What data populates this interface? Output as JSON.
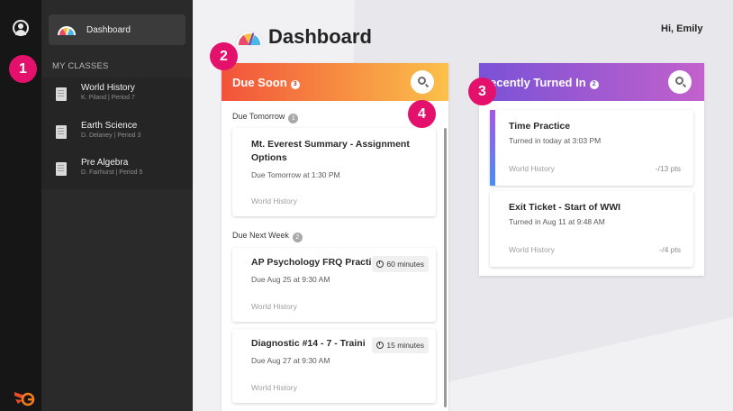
{
  "nav": {
    "dashboard_label": "Dashboard"
  },
  "sidebar": {
    "section_label": "MY CLASSES",
    "classes": [
      {
        "name": "World History",
        "sub": "K. Piland  |  Period 7"
      },
      {
        "name": "Earth Science",
        "sub": "D. Delaney  |  Period 3"
      },
      {
        "name": "Pre Algebra",
        "sub": "D. Fairhurst  |  Period 5"
      }
    ]
  },
  "header": {
    "title": "Dashboard",
    "greeting": "Hi, Emily"
  },
  "badges": [
    "1",
    "2",
    "3",
    "4"
  ],
  "due_soon": {
    "title": "Due Soon",
    "count": "3",
    "sections": [
      {
        "label": "Due Tomorrow",
        "count": "1"
      },
      {
        "label": "Due Next Week",
        "count": "2"
      }
    ],
    "cards": [
      {
        "title": "Mt. Everest Summary - Assignment Options",
        "due": "Due Tomorrow at 1:30 PM",
        "class": "World History"
      },
      {
        "title": "AP Psychology FRQ Practi",
        "duration": "60 minutes",
        "due": "Due Aug 25 at 9:30 AM",
        "class": "World History"
      },
      {
        "title": "Diagnostic #14 - 7 - Traini",
        "duration": "15 minutes",
        "due": "Due Aug 27 at 9:30 AM",
        "class": "World History"
      }
    ]
  },
  "turned_in": {
    "title": "ecently Turned In",
    "count": "2",
    "cards": [
      {
        "title": "Time Practice",
        "status": "Turned in today at 3:03 PM",
        "class": "World History",
        "points": "-/13 pts"
      },
      {
        "title": "Exit Ticket - Start of WWI",
        "status": "Turned in Aug 11 at 9:48 AM",
        "class": "World History",
        "points": "-/4 pts"
      }
    ]
  },
  "colors": {
    "accent_badge": "#e3116c",
    "due_soon_gradient": [
      "#f2533a",
      "#fbc14a"
    ],
    "turned_in_gradient": [
      "#7a52d6",
      "#c261cc"
    ],
    "turned_in_stripe": [
      "#a757e0",
      "#4a8ff0"
    ]
  },
  "icons": [
    "user-icon",
    "logo-icon",
    "dashboard-gauge-icon",
    "book-icon",
    "search-icon",
    "info-icon",
    "clock-icon"
  ]
}
